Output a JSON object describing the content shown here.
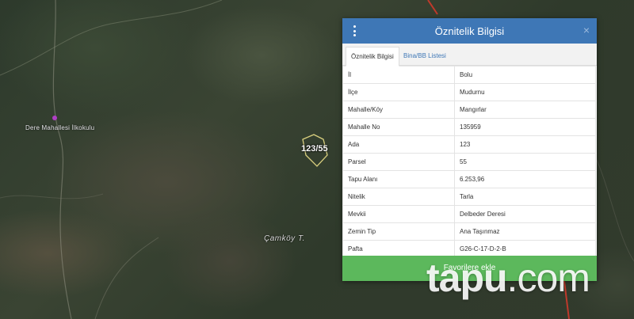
{
  "map": {
    "place_label": "Dere Mahallesi İlkokulu",
    "village_label": "Çamköy T.",
    "parcel_label": "123/55"
  },
  "panel": {
    "title": "Öznitelik Bilgisi",
    "menu_icon": "vertical-dots-icon",
    "close_icon": "close-icon",
    "close_glyph": "×",
    "tabs": [
      {
        "label": "Öznitelik Bilgisi",
        "active": true
      },
      {
        "label": "Bina/BB Listesi",
        "active": false
      }
    ],
    "rows": [
      {
        "key": "İl",
        "value": "Bolu"
      },
      {
        "key": "İlçe",
        "value": "Mudurnu"
      },
      {
        "key": "Mahalle/Köy",
        "value": "Mangırlar"
      },
      {
        "key": "Mahalle No",
        "value": "135959"
      },
      {
        "key": "Ada",
        "value": "123"
      },
      {
        "key": "Parsel",
        "value": "55"
      },
      {
        "key": "Tapu Alanı",
        "value": "6.253,96"
      },
      {
        "key": "Nitelik",
        "value": "Tarla"
      },
      {
        "key": "Mevkii",
        "value": "Delbeder Deresi"
      },
      {
        "key": "Zemin Tip",
        "value": "Ana Taşınmaz"
      },
      {
        "key": "Pafta",
        "value": "G26-C-17-D-2-B"
      }
    ],
    "favorite_button": "Favorilere ekle",
    "header_color": "#3e77b6",
    "button_color": "#5cb85c"
  },
  "watermark": {
    "brand": "tapu",
    "suffix": ".com"
  }
}
